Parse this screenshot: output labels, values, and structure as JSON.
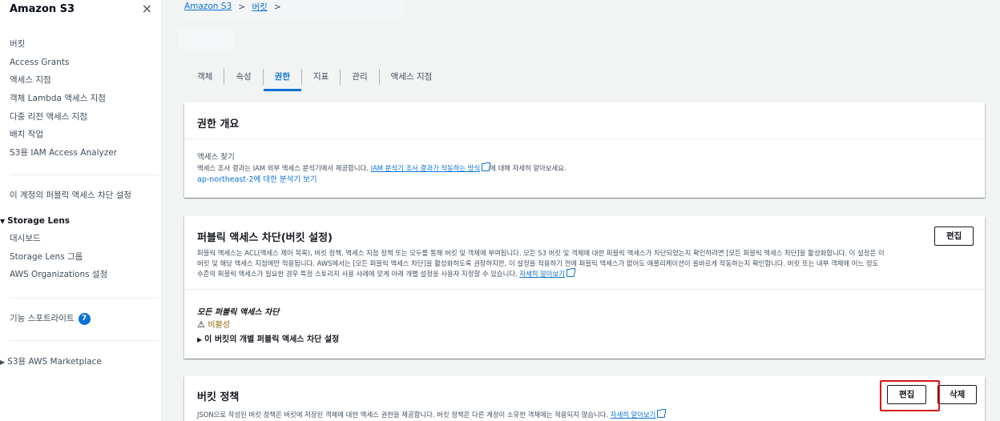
{
  "sidebar": {
    "title": "Amazon S3",
    "close_icon": "×",
    "items_top": [
      "버킷",
      "Access Grants",
      "액세스 지점",
      "객체 Lambda 액세스 지점",
      "다중 리전 액세스 지점",
      "배치 작업",
      "S3용 IAM Access Analyzer"
    ],
    "block_public_access": "이 계정의 퍼블릭 액세스 차단 설정",
    "storage_lens": {
      "title": "Storage Lens",
      "items": [
        "대시보드",
        "Storage Lens 그룹",
        "AWS Organizations 설정"
      ]
    },
    "feature_spotlight": "기능 스포트라이트",
    "feature_badge": "7",
    "marketplace": "S3용 AWS Marketplace"
  },
  "breadcrumb": {
    "root": "Amazon S3",
    "bucket": "버킷",
    "separator": ">"
  },
  "tabs": [
    "객체",
    "속성",
    "권한",
    "지표",
    "관리",
    "액세스 지점"
  ],
  "active_tab": "권한",
  "permissions_overview": {
    "title": "권한 개요",
    "access_label": "액세스 찾기",
    "description_prefix": "액세스 조사 결과는 IAM 외부 액세스 분석기에서 제공합니다.",
    "description_link": "IAM 분석기 조사 결과가 작동하는 방식",
    "description_suffix": "에 대해 자세히 알아보세요.",
    "analyzer_link": "ap-northeast-2에 대한 분석기 보기"
  },
  "block_public_access": {
    "title": "퍼블릭 액세스 차단(버킷 설정)",
    "edit_label": "편집",
    "description_line1": "퍼블릭 액세스는 ACL(액세스 제어 목록), 버킷 정책, 액세스 지점 정책 또는 모두를 통해 버킷 및 객체에 부여됩니다. 모든 S3 버킷 및 객체에 대한 퍼블릭 액세스가 차단되었는지 확인하려면 [모든 퍼블릭 액세스 차단]을 활성화합니다. 이 설정은 이",
    "description_line2": "버킷 및 해당 액세스 지점에만 적용됩니다. AWS에서는 [모든 퍼블릭 액세스 차단]을 활성화하도록 권장하지만, 이 설정을 적용하기 전에 퍼블릭 액세스가 없어도 애플리케이션이 올바르게 작동하는지 확인합니다. 버킷 또는 내부 객체에 어느 정도",
    "description_line3": "수준의 퍼블릭 액세스가 필요한 경우 특정 스토리지 사용 사례에 맞게 아래 개별 설정을 사용자 지정할 수 있습니다.",
    "learn_more": "자세히 알아보기",
    "setting_label": "모든 퍼블릭 액세스 차단",
    "status_icon": "⚠",
    "status": "비활성",
    "expand_label": "이 버킷의 개별 퍼블릭 액세스 차단 설정"
  },
  "bucket_policy": {
    "title": "버킷 정책",
    "edit_label": "편집",
    "delete_label": "삭제",
    "description": "JSON으로 작성된 버킷 정책은 버킷에 저장된 객체에 대한 액세스 권한을 제공합니다. 버킷 정책은 다른 계정이 소유한 객체에는 적용되지 않습니다.",
    "learn_more": "자세히 알아보기"
  },
  "colors": {
    "link": "#0972d3",
    "highlight": "#d91515",
    "warning": "#8d6605"
  }
}
